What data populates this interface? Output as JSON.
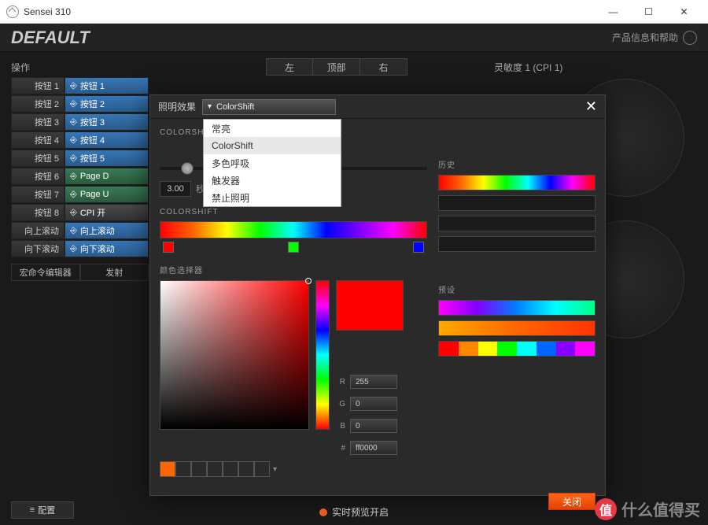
{
  "titlebar": {
    "title": "Sensei 310"
  },
  "header": {
    "title": "DEFAULT",
    "help": "产品信息和帮助"
  },
  "toolbar": {
    "ops": "操作"
  },
  "viewTabs": [
    "左",
    "顶部",
    "右"
  ],
  "sensitivity": "灵敏度 1 (CPI 1)",
  "buttons": [
    {
      "l": "按钮 1",
      "r": "按钮 1",
      "t": "n"
    },
    {
      "l": "按钮 2",
      "r": "按钮 2",
      "t": "n"
    },
    {
      "l": "按钮 3",
      "r": "按钮 3",
      "t": "n"
    },
    {
      "l": "按钮 4",
      "r": "按钮 4",
      "t": "n"
    },
    {
      "l": "按钮 5",
      "r": "按钮 5",
      "t": "n"
    },
    {
      "l": "按钮 6",
      "r": "Page D",
      "t": "p"
    },
    {
      "l": "按钮 7",
      "r": "Page U",
      "t": "p"
    },
    {
      "l": "按钮 8",
      "r": "CPI 开",
      "t": "c"
    },
    {
      "l": "向上滚动",
      "r": "向上滚动",
      "t": "n"
    },
    {
      "l": "向下滚动",
      "r": "向下滚动",
      "t": "n"
    }
  ],
  "bottombar": {
    "macro": "宏命令编辑器",
    "launch": "发射"
  },
  "modal": {
    "label": "照明效果",
    "selected": "ColorShift",
    "options": [
      "常亮",
      "ColorShift",
      "多色呼吸",
      "触发器",
      "禁止照明"
    ],
    "section1": "COLORSHIFT",
    "speed": "3.00",
    "speedUnit": "秒",
    "section2": "COLORSHIFT",
    "markers": [
      "#ff0000",
      "#00ff00",
      "#0000ff"
    ],
    "pickerLabel": "颜色选择器",
    "rgb": {
      "r": "255",
      "g": "0",
      "b": "0",
      "hex": "ff0000"
    },
    "history": "历史",
    "presets": "预设",
    "presetBlocks": [
      "#ff0000",
      "#ff8800",
      "#ffff00",
      "#00ff00",
      "#00ffff",
      "#0066ff",
      "#8800ff",
      "#ff00ff"
    ],
    "close": "关闭"
  },
  "footer": {
    "config": "配置",
    "preview": "实时预览开启"
  },
  "watermark": "什么值得买",
  "wmIcon": "值"
}
